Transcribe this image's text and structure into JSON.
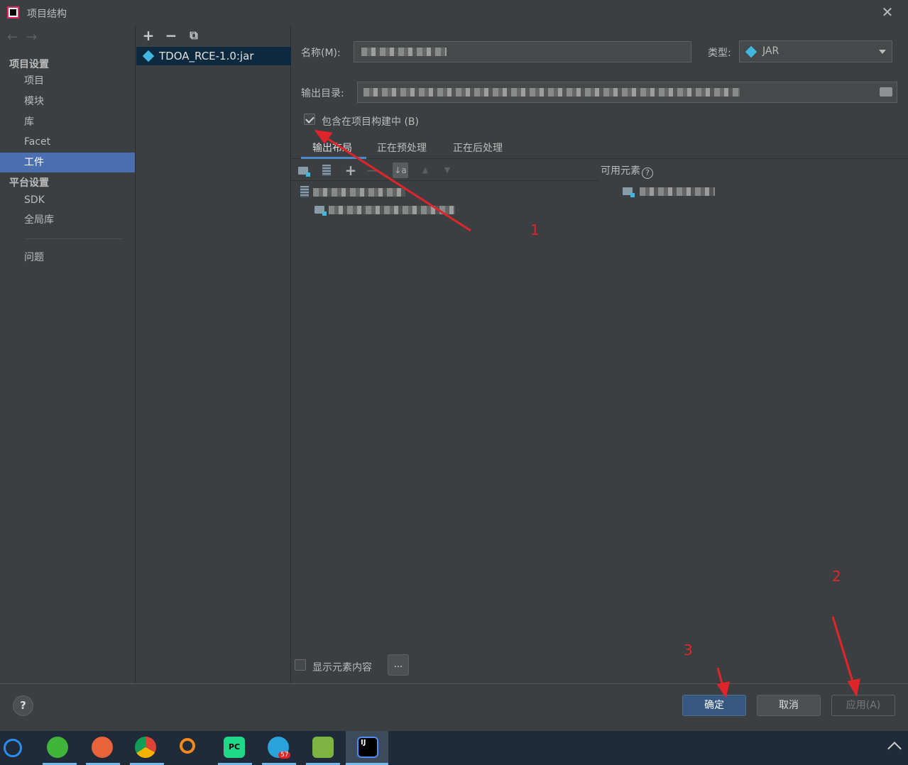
{
  "window": {
    "title": "项目结构",
    "close_glyph": "✕"
  },
  "leftnav": {
    "back_glyph": "←",
    "forward_glyph": "→",
    "project_settings_header": "项目设置",
    "platform_settings_header": "平台设置",
    "items": [
      {
        "label": "项目"
      },
      {
        "label": "模块"
      },
      {
        "label": "库"
      },
      {
        "label": "Facet"
      },
      {
        "label": "工件",
        "active": true
      }
    ],
    "platform_items": [
      {
        "label": "SDK"
      },
      {
        "label": "全局库"
      }
    ],
    "problems": "问题"
  },
  "artifacts": {
    "add_glyph": "+",
    "remove_glyph": "−",
    "copy_glyph": "⧉",
    "list": [
      {
        "name": "TDOA_RCE-1.0:jar",
        "selected": true
      }
    ]
  },
  "form": {
    "name_label": "名称(M):",
    "type_label": "类型:",
    "type_value": "JAR",
    "output_dir_label": "输出目录:",
    "include_in_build_label": "包含在项目构建中 (B)",
    "include_in_build_checked": true
  },
  "tabs": [
    {
      "label": "输出布局",
      "active": true
    },
    {
      "label": "正在预处理"
    },
    {
      "label": "正在后处理"
    }
  ],
  "layout_toolbar": {
    "add_glyph": "+",
    "remove_glyph": "−",
    "sort_glyph": "↓a",
    "up_glyph": "▲",
    "down_glyph": "▼"
  },
  "available_elements": {
    "label": "可用元素",
    "help_glyph": "?"
  },
  "bottom_options": {
    "show_content_label": "显示元素内容",
    "show_content_checked": false,
    "ellipsis": "..."
  },
  "footer": {
    "help_glyph": "?",
    "ok_label": "确定",
    "cancel_label": "取消",
    "apply_label": "应用(A)"
  },
  "annotations": {
    "num1": "1",
    "num2": "2",
    "num3": "3",
    "color": "#e0252a"
  },
  "taskbar": {
    "badge": "57",
    "pc_label": "PC",
    "ij_label": "IJ"
  },
  "colors": {
    "bg": "#3c3f41",
    "selection": "#4b6eaf",
    "primary_button": "#365880",
    "tab_underline": "#4a88c7"
  }
}
